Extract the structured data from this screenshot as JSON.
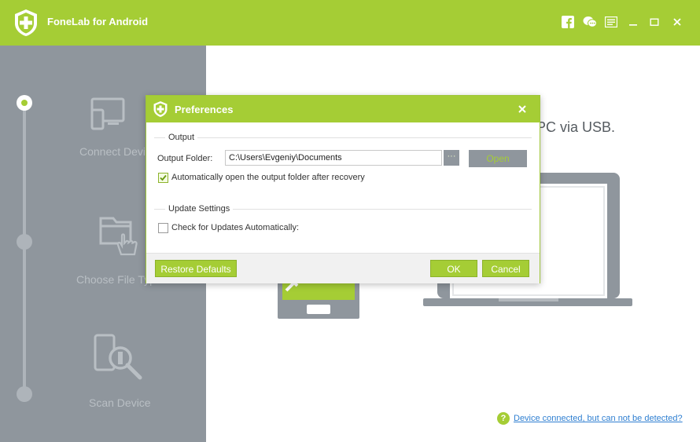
{
  "app": {
    "title": "FoneLab for Android"
  },
  "titlebar": {
    "icons": [
      "facebook-icon",
      "feedback-icon",
      "menu-icon",
      "minimize-icon",
      "maximize-icon",
      "close-icon"
    ],
    "accent": "#a5cd35"
  },
  "sidebar": {
    "steps": [
      {
        "label": "Connect Device",
        "icon": "connect-device-icon",
        "active": true
      },
      {
        "label": "Choose File Type",
        "icon": "choose-file-type-icon",
        "active": false
      },
      {
        "label": "Scan Device",
        "icon": "scan-device-icon",
        "active": false
      }
    ]
  },
  "main": {
    "instruction": "PC via USB.",
    "help_link": "Device connected, but can not be detected?"
  },
  "dialog": {
    "title": "Preferences",
    "output_section": "Output",
    "output_folder_label": "Output Folder:",
    "output_folder_value": "C:\\Users\\Evgeniy\\Documents",
    "browse_label": "···",
    "open_label": "Open",
    "auto_open_label": "Automatically open the output folder after recovery",
    "auto_open_checked": true,
    "update_section": "Update Settings",
    "check_updates_label": "Check for Updates Automatically:",
    "check_updates_checked": false,
    "restore_defaults_label": "Restore Defaults",
    "ok_label": "OK",
    "cancel_label": "Cancel"
  }
}
